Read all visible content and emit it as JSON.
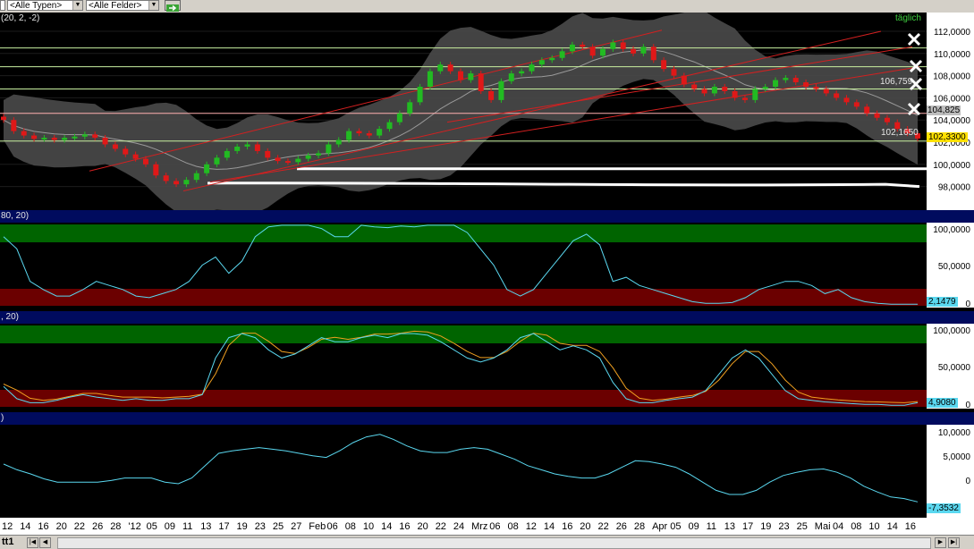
{
  "toolbar": {
    "type_filter": "<Alle Typen>",
    "field_filter": "<Alle Felder>"
  },
  "panels": {
    "price": {
      "header": "(20, 2, -2)",
      "period_label": "täglich"
    },
    "osc1": {
      "header": "80, 20)"
    },
    "osc2": {
      "header": ", 20)"
    },
    "osc3": {
      "header": ")"
    }
  },
  "axis_labels": {
    "price": [
      "112,0000",
      "110,0000",
      "108,0000",
      "106,0000",
      "104,0000",
      "102,0000",
      "100,0000",
      "98,0000"
    ],
    "osc1": [
      "100,0000",
      "50,0000",
      "0"
    ],
    "osc2": [
      "100,0000",
      "50,0000",
      "0"
    ],
    "osc3": [
      "10,0000",
      "5,0000",
      "0"
    ]
  },
  "price_tags": {
    "upper_band": "106,759",
    "middle_band": "104,825",
    "lower_band": "102,1650",
    "last": "102,3300"
  },
  "indicator_values": {
    "osc1": "2,1479",
    "osc2": "4,9080",
    "osc3": "-7,3532"
  },
  "date_axis": [
    "12",
    "14",
    "16",
    "20",
    "22",
    "26",
    "28",
    "'12",
    "05",
    "09",
    "11",
    "13",
    "17",
    "19",
    "23",
    "25",
    "27",
    "Feb",
    "06",
    "08",
    "10",
    "14",
    "16",
    "20",
    "22",
    "24",
    "Mrz",
    "06",
    "08",
    "12",
    "14",
    "16",
    "20",
    "22",
    "26",
    "28",
    "Apr",
    "05",
    "09",
    "11",
    "13",
    "17",
    "19",
    "23",
    "25",
    "Mai",
    "04",
    "08",
    "10",
    "14",
    "16"
  ],
  "tabbar": {
    "tab_label": "tt1"
  },
  "colors": {
    "up": "#22bb22",
    "down": "#e01818",
    "band_fill": "#555555",
    "zone_high": "#006400",
    "zone_low": "#6b0000",
    "osc_line": "#5ad8f0",
    "osc_line2": "#f0a020",
    "header_bg": "#000b5e"
  },
  "chart_data": {
    "type": "line",
    "title": "",
    "series": [
      {
        "name": "",
        "values": [
          104.0,
          103.0,
          102.6,
          102.3,
          102.4,
          102.2,
          102.4,
          102.5,
          102.7,
          102.4,
          101.8,
          101.4,
          100.9,
          100.5,
          100.0,
          99.0,
          98.5,
          98.2,
          98.6,
          99.2,
          100.0,
          100.6,
          101.2,
          101.6,
          101.8,
          101.2,
          100.6,
          100.3,
          100.2,
          100.5,
          100.8,
          101.0,
          101.8,
          102.2,
          103.0,
          102.8,
          102.6,
          103.2,
          103.8,
          104.6,
          105.6,
          107.0,
          108.4,
          109.0,
          108.4,
          107.6,
          108.2,
          106.6,
          105.8,
          107.5,
          108.2,
          108.4,
          109.0,
          109.4,
          109.6,
          110.2,
          110.8,
          110.6,
          109.8,
          110.4,
          111.0,
          110.4,
          110.0,
          110.6,
          109.4,
          108.6,
          108.0,
          107.2,
          106.8,
          106.4,
          107.0,
          106.6,
          106.0,
          105.8,
          106.8,
          107.0,
          107.6,
          107.8,
          107.4,
          107.0,
          106.8,
          106.4,
          106.0,
          105.6,
          105.2,
          104.6,
          104.2,
          103.8,
          103.2,
          102.8,
          102.33
        ]
      }
    ]
  }
}
